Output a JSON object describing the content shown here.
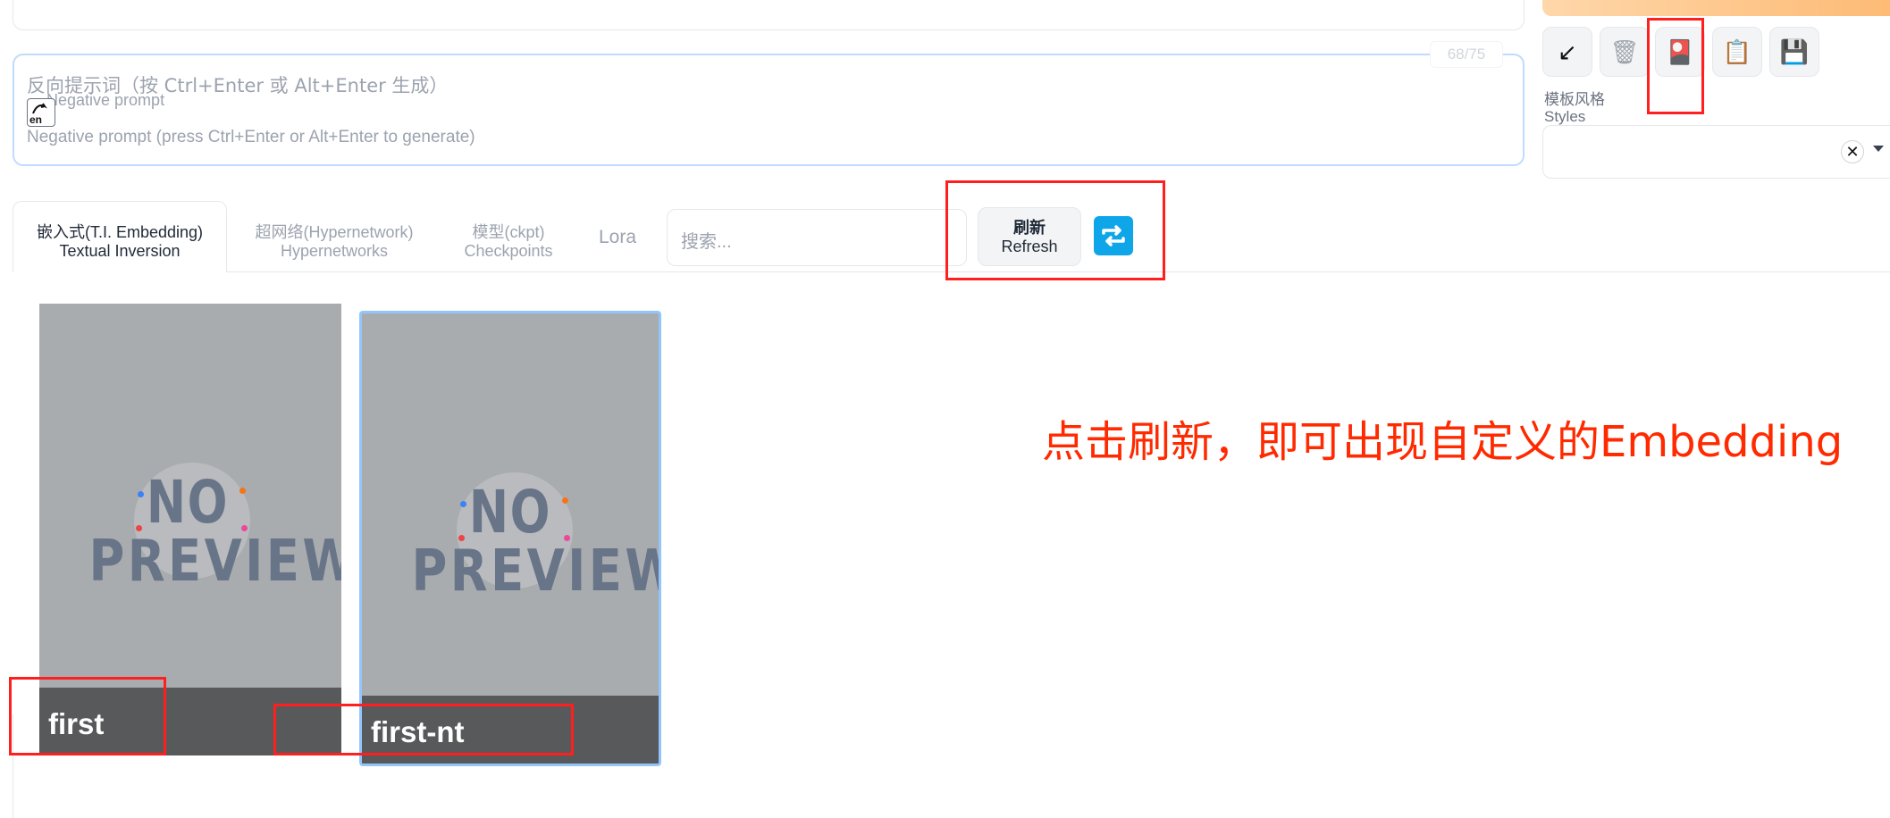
{
  "negative_prompt": {
    "label": "反向提示词（按 Ctrl+Enter 或 Alt+Enter 生成）",
    "sub_label": "Negative prompt",
    "placeholder": "Negative prompt (press Ctrl+Enter or Alt+Enter to generate)",
    "token_count": "68/75",
    "translate_icon_text": "en"
  },
  "toolbar": {
    "buttons": [
      {
        "icon": "arrow-down-left-icon",
        "glyph": "↙"
      },
      {
        "icon": "trash-icon",
        "glyph": "🗑"
      },
      {
        "icon": "extra-networks-icon",
        "glyph": "🎴"
      },
      {
        "icon": "clipboard-icon",
        "glyph": "📋"
      },
      {
        "icon": "save-icon",
        "glyph": "💾"
      }
    ]
  },
  "styles": {
    "label_zh": "模板风格",
    "label_en": "Styles",
    "clear_glyph": "✕"
  },
  "tabs": [
    {
      "zh": "嵌入式(T.I. Embedding)",
      "en": "Textual Inversion",
      "active": true
    },
    {
      "zh": "超网络(Hypernetwork)",
      "en": "Hypernetworks",
      "active": false
    },
    {
      "zh": "模型(ckpt)",
      "en": "Checkpoints",
      "active": false
    },
    {
      "zh": "Lora",
      "en": "",
      "active": false
    }
  ],
  "search": {
    "placeholder": "搜索..."
  },
  "refresh": {
    "zh": "刷新",
    "en": "Refresh"
  },
  "cards": [
    {
      "name": "first",
      "preview_line1": "NO",
      "preview_line2": "PREVIEW",
      "selected": false
    },
    {
      "name": "first-nt",
      "preview_line1": "NO",
      "preview_line2": "PREVIEW",
      "selected": true
    }
  ],
  "annotation": {
    "text": "点击刷新，即可出现自定义的Embedding",
    "color": "#ff2a00"
  },
  "colors": {
    "accent": "#0ea5e9",
    "highlight": "#ff1f1f",
    "selected_border": "#93c5fd"
  }
}
